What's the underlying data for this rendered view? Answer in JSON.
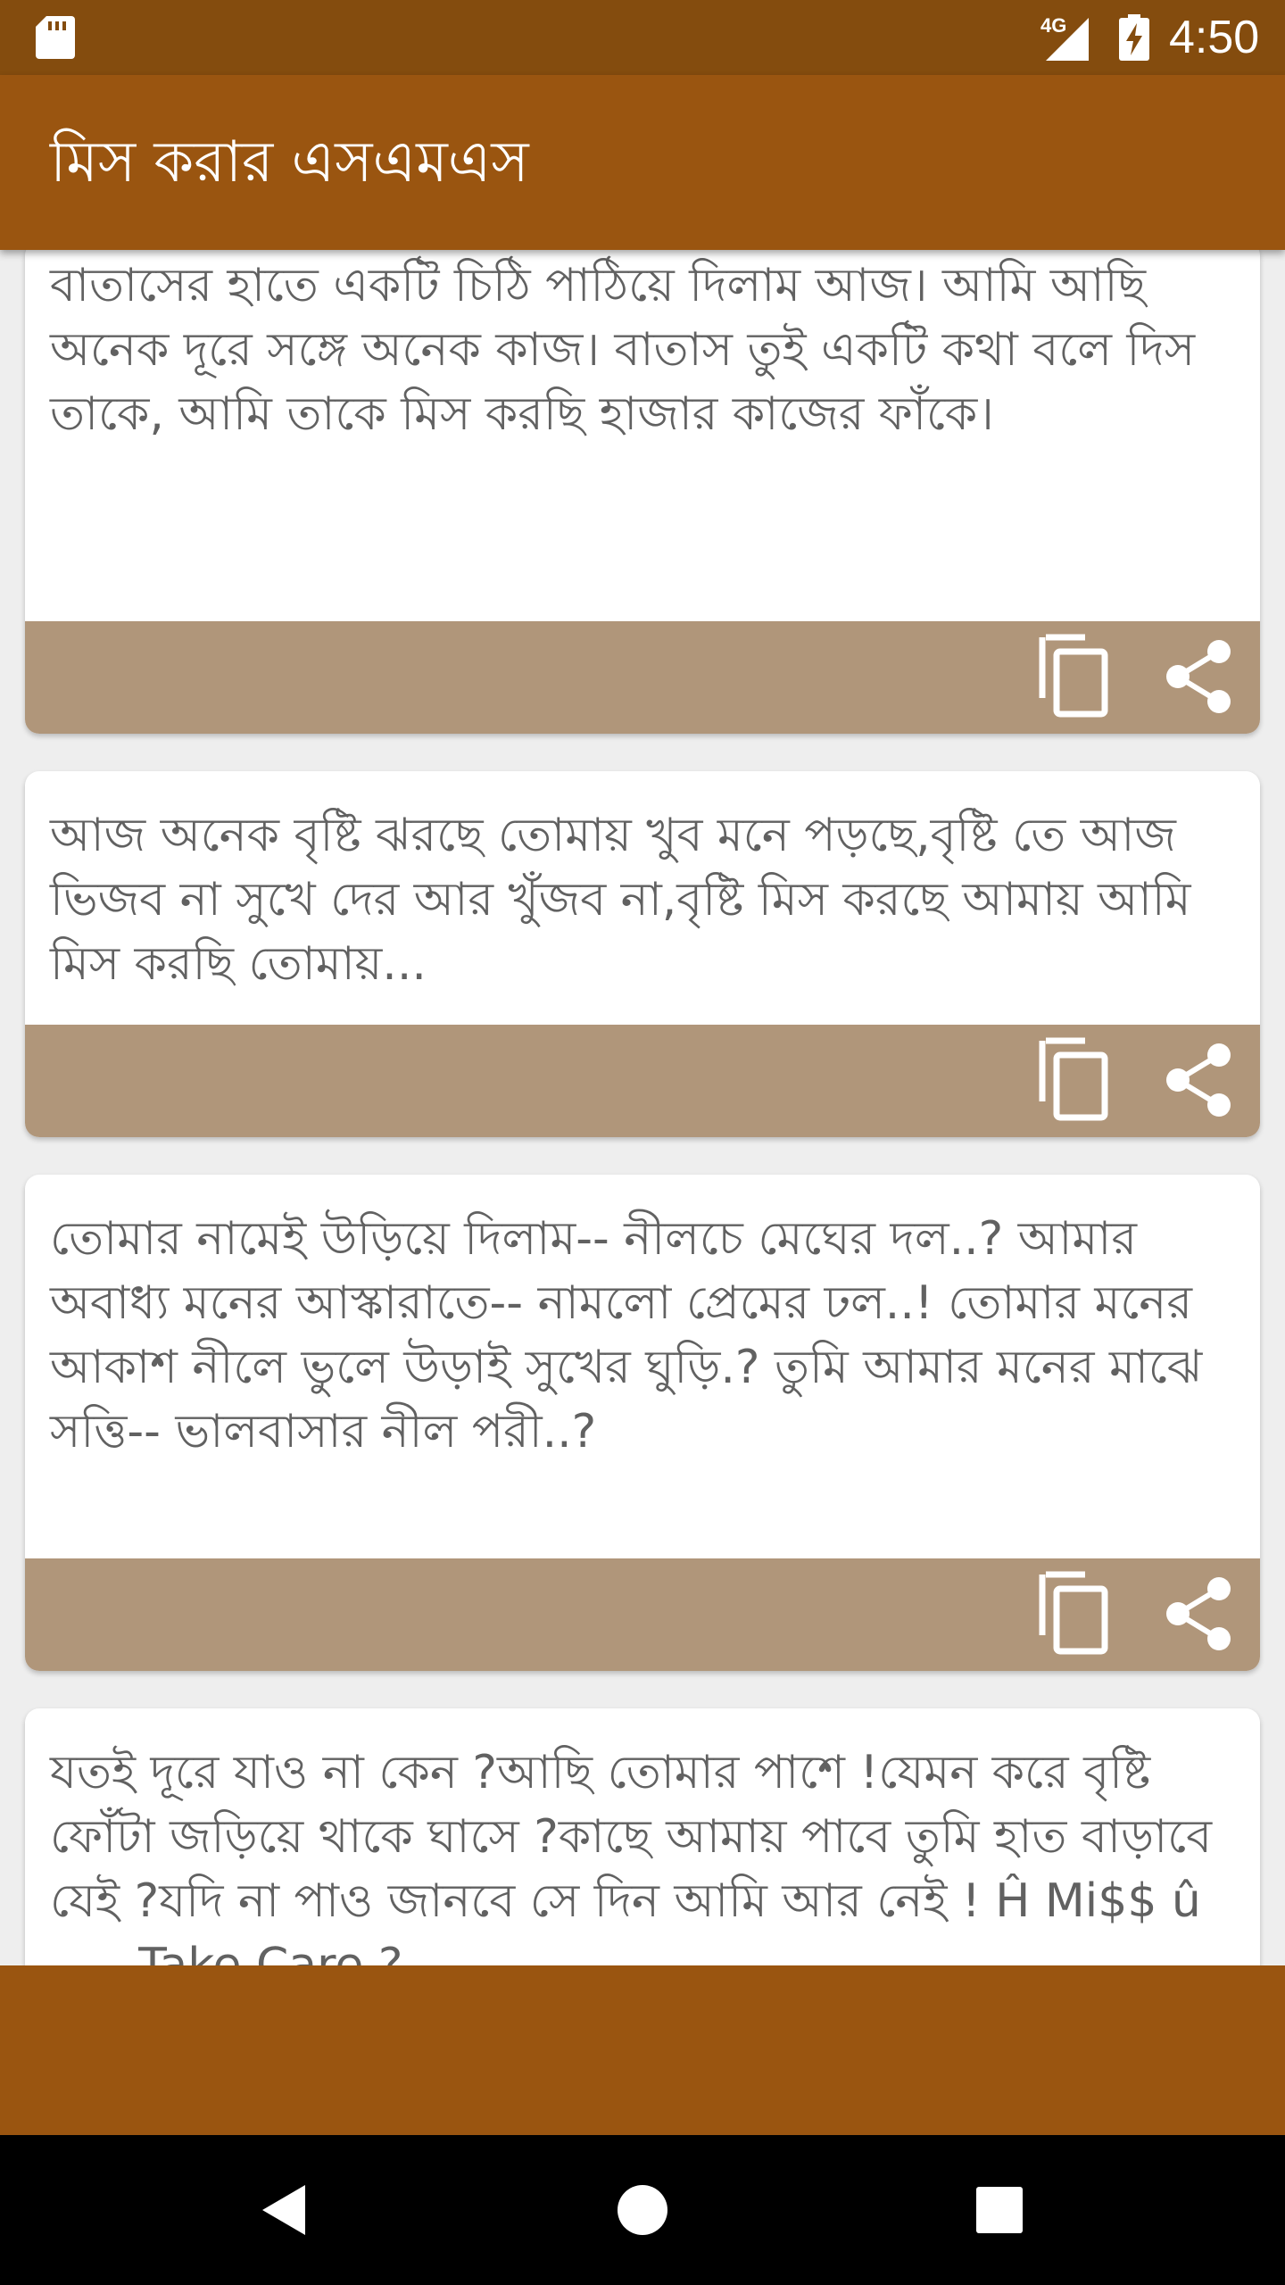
{
  "status_bar": {
    "network": "4G",
    "time": "4:50"
  },
  "app_bar": {
    "title": "মিস করার এসএমএস"
  },
  "messages": [
    {
      "text": "বাতাসের হাতে একটি চিঠি পাঠিয়ে দিলাম আজ। আমি আছি অনেক দূরে সঙ্গে অনেক কাজ। বাতাস তুই একটি কথা বলে দিস তাকে, আমি তাকে মিস করছি হাজার কাজের ফাঁকে।"
    },
    {
      "text": "আজ অনেক বৃষ্টি ঝরছে তোমায় খুব মনে পড়ছে,বৃষ্টি তে আজ ভিজব না সুখে দের আর খুঁজব না,বৃষ্টি মিস করছে আমায় আমি মিস করছি তোমায়..."
    },
    {
      "text": "তোমার নামেই উড়িয়ে দিলাম-- নীলচে মেঘের দল..? আমার অবাধ্য মনের আস্কারাতে-- নামলো প্রেমের ঢল..! তোমার মনের আকাশ নীলে ভুলে উড়াই সুখের ঘুড়ি.? তুমি আমার মনের মাঝে সত্তি-- ভালবাসার নীল পরী..?"
    },
    {
      "text": "যতই দূরে যাও না কেন ?আছি তোমার পাশে !যেমন করে বৃষ্টি ফোঁটা জড়িয়ে থাকে ঘাসে ?কাছে আমায় পাবে তুমি হাত বাড়াবে যেই ?যদি না পাও জানবে সে দিন আমি আর নেই ! Ĥ Mi$$ û ..... Take Care ?"
    }
  ],
  "colors": {
    "status_bar": "#844c0e",
    "primary": "#9a5510",
    "card_actions": "#b0967a",
    "text": "#616161"
  },
  "icons": {
    "copy": "copy-icon",
    "share": "share-icon"
  }
}
